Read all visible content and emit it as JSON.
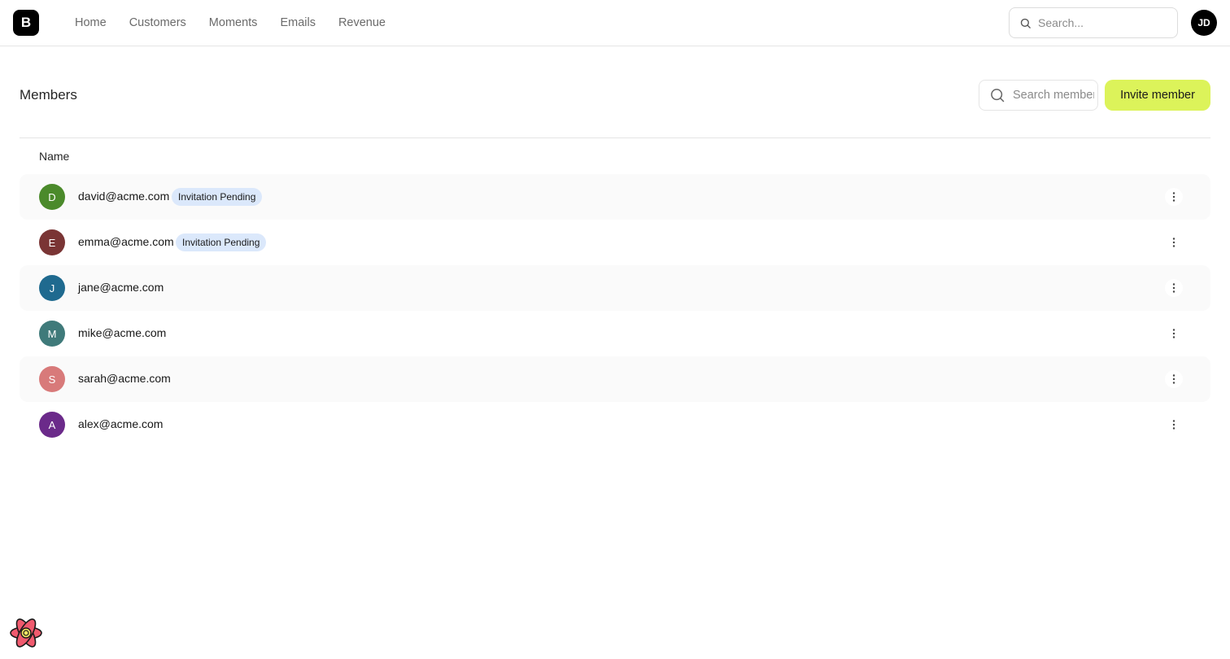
{
  "header": {
    "logo_text": "B",
    "nav": [
      "Home",
      "Customers",
      "Moments",
      "Emails",
      "Revenue"
    ],
    "search_placeholder": "Search...",
    "user_initials": "JD"
  },
  "page": {
    "title": "Members",
    "search_placeholder": "Search members",
    "invite_label": "Invite member",
    "column_name": "Name"
  },
  "members": [
    {
      "initial": "D",
      "email": "david@acme.com",
      "badge": "Invitation Pending",
      "color": "#4b8a2b"
    },
    {
      "initial": "E",
      "email": "emma@acme.com",
      "badge": "Invitation Pending",
      "color": "#7a3535"
    },
    {
      "initial": "J",
      "email": "jane@acme.com",
      "badge": "",
      "color": "#1f6a8f"
    },
    {
      "initial": "M",
      "email": "mike@acme.com",
      "badge": "",
      "color": "#3f7a7a"
    },
    {
      "initial": "S",
      "email": "sarah@acme.com",
      "badge": "",
      "color": "#d87a7a"
    },
    {
      "initial": "A",
      "email": "alex@acme.com",
      "badge": "",
      "color": "#6b2a8a"
    }
  ],
  "icons": {
    "search": "search-icon",
    "more": "more-vertical-icon",
    "react": "react-logo-icon"
  },
  "colors": {
    "accent": "#dcf35a",
    "badge_bg": "#dbe8fb"
  }
}
